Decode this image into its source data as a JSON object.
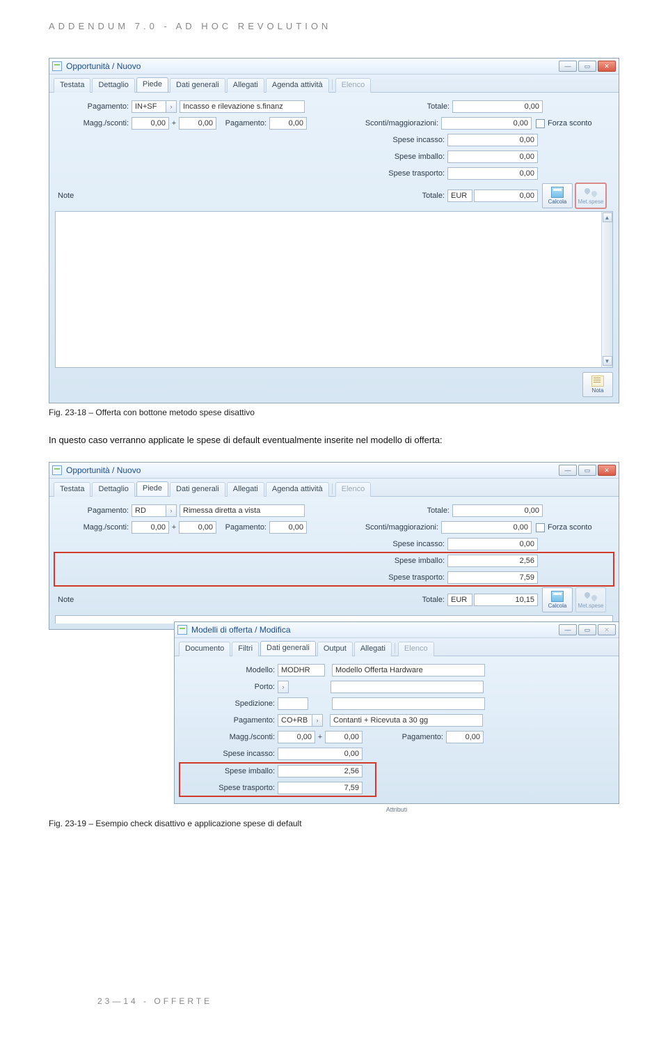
{
  "header": "ADDENDUM 7.0 - AD HOC REVOLUTION",
  "fig1": {
    "title": "Opportunità / Nuovo",
    "tabs": [
      "Testata",
      "Dettaglio",
      "Piede",
      "Dati generali",
      "Allegati",
      "Agenda attività",
      "Elenco"
    ],
    "labels": {
      "pagamento": "Pagamento:",
      "magg": "Magg./sconti:",
      "pagamento2": "Pagamento:",
      "totale": "Totale:",
      "sconti": "Sconti/maggiorazioni:",
      "spese_incasso": "Spese incasso:",
      "spese_imballo": "Spese imballo:",
      "spese_trasporto": "Spese trasporto:",
      "totale2": "Totale:",
      "forza": "Forza sconto",
      "note": "Note"
    },
    "pag_code": "IN+SF",
    "pag_desc": "Incasso e rilevazione s.finanz",
    "magg1": "0,00",
    "magg2": "0,00",
    "pag2": "0,00",
    "totale": "0,00",
    "sconti": "0,00",
    "sp_inc": "0,00",
    "sp_imb": "0,00",
    "sp_tra": "0,00",
    "tot_cur": "EUR",
    "tot2": "0,00",
    "btn_calcola": "Calcola",
    "btn_met": "Met.spese",
    "btn_nota": "Nota"
  },
  "caption1": "Fig. 23-18 – Offerta con bottone metodo spese disattivo",
  "body1": "In questo caso verranno applicate le spese di default eventualmente inserite nel modello di offerta:",
  "fig2": {
    "title": "Opportunità / Nuovo",
    "tabs": [
      "Testata",
      "Dettaglio",
      "Piede",
      "Dati generali",
      "Allegati",
      "Agenda attività",
      "Elenco"
    ],
    "labels": {
      "pagamento": "Pagamento:",
      "magg": "Magg./sconti:",
      "pagamento2": "Pagamento:",
      "totale": "Totale:",
      "sconti": "Sconti/maggiorazioni:",
      "spese_incasso": "Spese incasso:",
      "spese_imballo": "Spese imballo:",
      "spese_trasporto": "Spese trasporto:",
      "totale2": "Totale:",
      "forza": "Forza sconto",
      "note": "Note"
    },
    "pag_code": "RD",
    "pag_desc": "Rimessa diretta a vista",
    "magg1": "0,00",
    "magg2": "0,00",
    "pag2": "0,00",
    "totale": "0,00",
    "sconti": "0,00",
    "sp_inc": "0,00",
    "sp_imb": "2,56",
    "sp_tra": "7,59",
    "tot_cur": "EUR",
    "tot2": "10,15",
    "btn_calcola": "Calcola",
    "btn_met": "Met.spese"
  },
  "fig3": {
    "title": "Modelli di offerta / Modifica",
    "tabs": [
      "Documento",
      "Filtri",
      "Dati generali",
      "Output",
      "Allegati",
      "Elenco"
    ],
    "labels": {
      "modello": "Modello:",
      "porto": "Porto:",
      "spedizione": "Spedizione:",
      "pagamento": "Pagamento:",
      "magg": "Magg./sconti:",
      "pagamento2": "Pagamento:",
      "spese_incasso": "Spese incasso:",
      "spese_imballo": "Spese imballo:",
      "spese_trasporto": "Spese trasporto:"
    },
    "mod_code": "MODHR",
    "mod_desc": "Modello Offerta Hardware",
    "pag_code": "CO+RB",
    "pag_desc": "Contanti + Ricevuta a 30 gg",
    "magg1": "0,00",
    "magg2": "0,00",
    "pag2": "0,00",
    "sp_inc": "0,00",
    "sp_imb": "2,56",
    "sp_tra": "7,59"
  },
  "caption2": "Fig. 23-19 – Esempio check disattivo e applicazione spese di default",
  "cut_label": "Attributi",
  "footer": "23—14 - OFFERTE"
}
